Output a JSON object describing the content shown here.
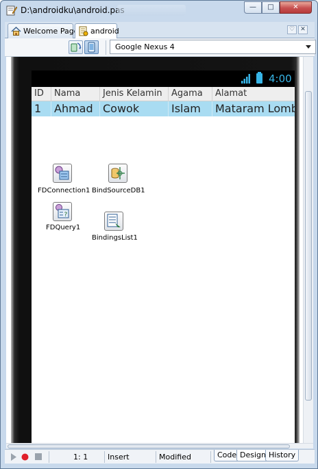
{
  "window": {
    "title": "D:\\androidku\\android.pas",
    "min_label": "—",
    "max_label": "□",
    "close_label": "✕"
  },
  "tabs": [
    {
      "label": "Welcome Page",
      "icon": "home-icon"
    },
    {
      "label": "android",
      "icon": "unit-file-icon"
    }
  ],
  "tab_controls": {
    "dropdown": "♡",
    "close": "✕"
  },
  "toolbar": {
    "device_combo_value": "Google Nexus 4",
    "device_icon": "tablet-icon",
    "orientation_icon": "rotate-icon"
  },
  "device": {
    "clock": "4:00",
    "grid": {
      "columns": [
        "ID",
        "Nama",
        "Jenis Kelamin",
        "Agama",
        "Alamat"
      ],
      "rows": [
        [
          "1",
          "Ahmad",
          "Cowok",
          "Islam",
          "Mataram Lombok"
        ]
      ]
    }
  },
  "components": [
    {
      "label": "FDConnection1",
      "icon": "fdconnection-icon"
    },
    {
      "label": "BindSourceDB1",
      "icon": "bindsource-icon"
    },
    {
      "label": "FDQuery1",
      "icon": "fdquery-icon"
    },
    {
      "label": "BindingsList1",
      "icon": "bindingslist-icon"
    }
  ],
  "statusbar": {
    "position": "1:   1",
    "mode": "Insert",
    "state": "Modified",
    "view_tabs": [
      "Code",
      "Design",
      "History"
    ],
    "active_view": "Design"
  },
  "colors": {
    "selected_row": "#a9dcf2",
    "clock": "#37b5e7",
    "chrome": "#c8d9ec"
  }
}
